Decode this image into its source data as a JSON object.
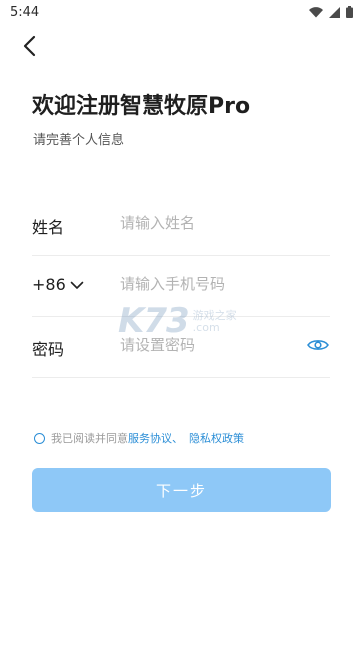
{
  "status_bar": {
    "time": "5:44",
    "icons": [
      "wifi-icon",
      "signal-icon",
      "battery-icon"
    ]
  },
  "header": {
    "back_icon": "back-arrow-icon",
    "title": "欢迎注册智慧牧原Pro",
    "subtitle": "请完善个人信息"
  },
  "form": {
    "name": {
      "label": "姓名",
      "placeholder": "请输入姓名",
      "value": ""
    },
    "phone": {
      "country_code": "+86",
      "placeholder": "请输入手机号码",
      "value": ""
    },
    "password": {
      "label": "密码",
      "placeholder": "请设置密码",
      "value": "",
      "toggle_icon": "eye-icon"
    }
  },
  "agreement": {
    "checked": false,
    "prefix": "我已阅读并同意",
    "service_link": "服务协议",
    "separator": "、",
    "privacy_link": "隐私权政策"
  },
  "next_button": {
    "label": "下一步"
  },
  "watermark": {
    "brand": "K73",
    "line1": "游戏之家",
    "line2": ".com"
  },
  "colors": {
    "accent": "#2b8ed6",
    "button_disabled": "#8ec8f7",
    "divider": "#ececec",
    "placeholder": "#b3b3b3"
  }
}
